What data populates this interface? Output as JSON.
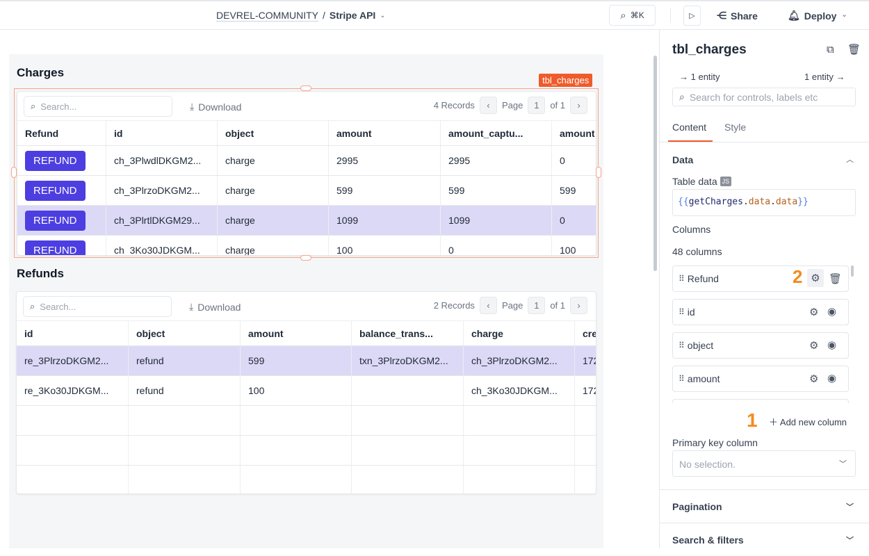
{
  "topbar": {
    "workspace": "DEVREL-COMMUNITY",
    "separator": "/",
    "app": "Stripe API",
    "shortcut": "⌘K",
    "share": "Share",
    "deploy": "Deploy"
  },
  "charges": {
    "title": "Charges",
    "widget_tag": "tbl_charges",
    "search_placeholder": "Search...",
    "download": "Download",
    "records": "4 Records",
    "page_label": "Page",
    "page": "1",
    "of": "of 1",
    "columns": [
      "Refund",
      "id",
      "object",
      "amount",
      "amount_captu...",
      "amount"
    ],
    "rows": [
      {
        "button": "REFUND",
        "cells": [
          "ch_3PlwdlDKGM2...",
          "charge",
          "2995",
          "2995",
          "0"
        ]
      },
      {
        "button": "REFUND",
        "cells": [
          "ch_3PlrzoDKGM2...",
          "charge",
          "599",
          "599",
          "599"
        ]
      },
      {
        "button": "REFUND",
        "cells": [
          "ch_3PlrtlDKGM29...",
          "charge",
          "1099",
          "1099",
          "0"
        ],
        "selected": true
      },
      {
        "button": "REFUND",
        "cells": [
          "ch_3Ko30JDKGM...",
          "charge",
          "100",
          "0",
          "100"
        ]
      }
    ]
  },
  "refunds": {
    "title": "Refunds",
    "search_placeholder": "Search...",
    "download": "Download",
    "records": "2 Records",
    "page_label": "Page",
    "page": "1",
    "of": "of 1",
    "columns": [
      "id",
      "object",
      "amount",
      "balance_trans...",
      "charge",
      "cre"
    ],
    "rows": [
      {
        "cells": [
          "re_3PlrzoDKGM2...",
          "refund",
          "599",
          "txn_3PlrzoDKGM2...",
          "ch_3PlrzoDKGM2...",
          "172"
        ],
        "selected": true
      },
      {
        "cells": [
          "re_3Ko30JDKGM...",
          "refund",
          "100",
          "",
          "ch_3Ko30JDKGM...",
          "172"
        ]
      },
      {
        "cells": [
          "",
          "",
          "",
          "",
          "",
          ""
        ]
      },
      {
        "cells": [
          "",
          "",
          "",
          "",
          "",
          ""
        ]
      },
      {
        "cells": [
          "",
          "",
          "",
          "",
          "",
          ""
        ]
      }
    ]
  },
  "panel": {
    "title": "tbl_charges",
    "entity_in": "1 entity",
    "entity_out": "1 entity",
    "search_placeholder": "Search for controls, labels etc",
    "tabs": [
      "Content",
      "Style"
    ],
    "data_section": "Data",
    "table_data_label": "Table data",
    "js_badge": "JS",
    "table_data_value": {
      "open": "{{",
      "obj": "getCharges",
      "dot1": ".",
      "p1": "data",
      "dot2": ".",
      "p2": "data",
      "close": "}}"
    },
    "columns_label": "Columns",
    "columns_count": "48 columns",
    "column_items": [
      "Refund",
      "id",
      "object",
      "amount"
    ],
    "add_column": "Add new column",
    "annotation_1": "1",
    "annotation_2": "2",
    "primary_key_label": "Primary key column",
    "primary_key_placeholder": "No selection.",
    "sections": [
      "Pagination",
      "Search & filters"
    ]
  },
  "colors": {
    "accent": "#ef5b2b",
    "button": "#4c3ee0",
    "selected_row": "#dcd9f6",
    "annotation": "#f58a1f"
  }
}
